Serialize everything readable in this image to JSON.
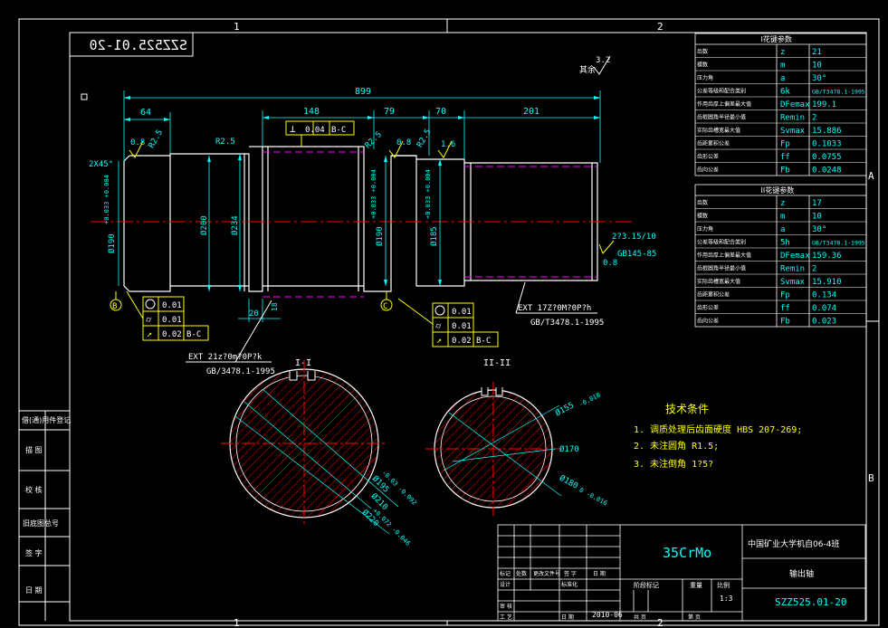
{
  "drawing": {
    "code_mirrored": "SZZ525.01-20",
    "zone_top_1": "1",
    "zone_top_2": "2",
    "zone_bottom_1": "1",
    "zone_bottom_2": "2",
    "zone_right_a": "A",
    "zone_right_b": "B",
    "surface_finish_note": "其余",
    "surface_finish_value": "3.2"
  },
  "dimensions": {
    "overall_length": "899",
    "seg_64": "64",
    "seg_148": "148",
    "seg_79": "79",
    "seg_70": "70",
    "seg_201": "201",
    "chamfer": "2X45°",
    "r_left": "R2.5",
    "r_mid1": "R2.5",
    "r_mid2": "R2.5",
    "r_right": "R2.5",
    "ra_1": "0.8",
    "ra_2": "0.8",
    "ra_3": "1.6",
    "ra_4": "0.8",
    "d190_left": "Ø190",
    "d190_left_tol": "+0.033 +0.004",
    "d200": "Ø200",
    "d234": "Ø234",
    "d190_mid": "Ø190",
    "d190_mid_tol": "+0.033 +0.004",
    "d185": "Ø185",
    "d185_tol": "+0.033 +0.004",
    "dim_20": "20",
    "dim_18": "18",
    "taper": "2?3.15/10",
    "taper_std": "GB145-85",
    "datum_b": "B",
    "datum_c": "C"
  },
  "tolerances": {
    "perp": {
      "symbol": "⊥",
      "value": "0.04",
      "datum": "B-C"
    },
    "left_cyl": "0.01",
    "left_round": "0.01",
    "left_runout": "0.02",
    "left_runout_datum": "B-C",
    "right_cyl": "0.01",
    "right_round": "0.01",
    "right_runout": "0.02",
    "right_runout_datum": "B-C"
  },
  "splines": {
    "left_label": "EXT 21z?0m?0P?k",
    "left_std": "GB/3478.1-1995",
    "right_label": "EXT 17Z?0M?0P?h",
    "right_std": "GB/T3478.1-1995"
  },
  "sections": {
    "left_title": "I-I",
    "right_title": "II-II",
    "left_d195": "Ø195",
    "left_d195_tol": "-0.03 -0.092",
    "left_d210": "Ø210",
    "left_d220": "Ø220",
    "left_d220_tol": "+0.072 -0.046",
    "right_d155": "Ø155",
    "right_d155_tol": "-0.018",
    "right_d170": "Ø170",
    "right_d180": "Ø180",
    "right_d180_tol": "0 -0.016"
  },
  "tech_req": {
    "title": "技术条件",
    "line1": "1. 调质处理后齿面硬度 HBS 207-269;",
    "line2": "2. 未注圆角 R1.5;",
    "line3": "3. 未注倒角 1?5?"
  },
  "spline_table_1": {
    "header": "I花键参数",
    "rows": [
      {
        "name": "齿数",
        "sym": "z",
        "val": "21"
      },
      {
        "name": "模数",
        "sym": "m",
        "val": "10"
      },
      {
        "name": "压力角",
        "sym": "a",
        "val": "30°"
      },
      {
        "name": "公差等级和配合类别",
        "sym": "6k",
        "val": "GB/T3478.1-1995"
      },
      {
        "name": "作用齿厚上偏差最大值",
        "sym": "DFemax",
        "val": "199.1"
      },
      {
        "name": "齿根圆角半径最小值",
        "sym": "Remin",
        "val": "2"
      },
      {
        "name": "实际齿槽宽最大值",
        "sym": "Svmax",
        "val": "15.886"
      },
      {
        "name": "齿距累积公差",
        "sym": "Fp",
        "val": "0.1033"
      },
      {
        "name": "齿形公差",
        "sym": "ff",
        "val": "0.0755"
      },
      {
        "name": "齿向公差",
        "sym": "Fb",
        "val": "0.0248"
      }
    ]
  },
  "spline_table_2": {
    "header": "II花键参数",
    "rows": [
      {
        "name": "齿数",
        "sym": "z",
        "val": "17"
      },
      {
        "name": "模数",
        "sym": "m",
        "val": "10"
      },
      {
        "name": "压力角",
        "sym": "a",
        "val": "30°"
      },
      {
        "name": "公差等级和配合类别",
        "sym": "5h",
        "val": "GB/T3478.1-1995"
      },
      {
        "name": "作用齿厚上偏差最大值",
        "sym": "DFemax",
        "val": "159.36"
      },
      {
        "name": "齿根圆角半径最小值",
        "sym": "Remin",
        "val": "2"
      },
      {
        "name": "实际齿槽宽最大值",
        "sym": "Svmax",
        "val": "15.910"
      },
      {
        "name": "齿距累积公差",
        "sym": "Fp",
        "val": "0.134"
      },
      {
        "name": "齿形公差",
        "sym": "ff",
        "val": "0.074"
      },
      {
        "name": "齿向公差",
        "sym": "Fb",
        "val": "0.023"
      }
    ]
  },
  "left_stamps": [
    "借(通)用件登记",
    "描 图",
    "校 核",
    "旧底图总号",
    "签 字",
    "日 期"
  ],
  "title_block": {
    "material": "35CrMo",
    "school": "中国矿业大学机自06-4班",
    "part_name": "输出轴",
    "drawing_no": "SZZ525.01-20",
    "scale": "1:3",
    "date": "2010-06",
    "stage_label": "阶段标记",
    "weight_label": "重量",
    "scale_label": "比例",
    "labels": [
      "标记",
      "处数",
      "更改文件号",
      "签 字",
      "日 期",
      "设计",
      "标准化",
      "审 核",
      "工 艺",
      "日 期",
      "共 页",
      "第 页"
    ]
  }
}
